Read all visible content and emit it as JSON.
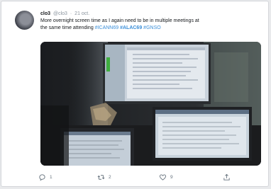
{
  "tweet": {
    "author_name": "clo3",
    "author_handle": "@clo3",
    "separator": "·",
    "date": "21 oct.",
    "text_part1": "More overnight screen time as I again need to be in multiple meetings at",
    "text_part2": "the same time attending",
    "hashtags": [
      "#ICANN69",
      "#ALAC69",
      "#GNSO"
    ]
  },
  "actions": {
    "reply_count": "1",
    "retweet_count": "2",
    "like_count": "9"
  },
  "icons": [
    "avatar",
    "reply-icon",
    "retweet-icon",
    "like-icon",
    "share-icon"
  ],
  "colors": {
    "hashtag": "#3b8fd9",
    "text": "#14171a",
    "muted": "#8a949e"
  }
}
